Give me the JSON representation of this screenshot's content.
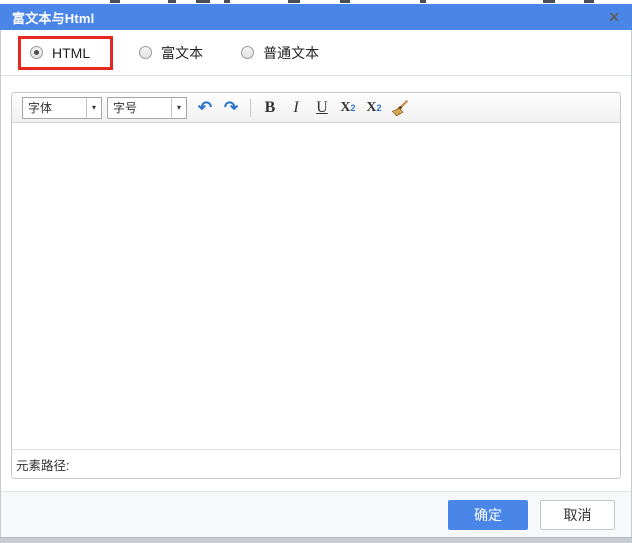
{
  "dialog": {
    "title": "富文本与Html"
  },
  "icons": {
    "close": "✕",
    "undo": "↶",
    "redo": "↷",
    "dropdown_arrow": "▾"
  },
  "mode_selector": {
    "options": [
      {
        "label": "HTML",
        "selected": true,
        "highlighted": true
      },
      {
        "label": "富文本",
        "selected": false,
        "highlighted": false
      },
      {
        "label": "普通文本",
        "selected": false,
        "highlighted": false
      }
    ],
    "highlight_color": "#e6281e"
  },
  "toolbar": {
    "font_family": {
      "value": "字体"
    },
    "font_size": {
      "value": "字号"
    },
    "buttons": {
      "bold": "B",
      "italic": "I",
      "underline": "U",
      "script_base": "X",
      "superscript_digit": "2",
      "subscript_digit": "2"
    }
  },
  "editor": {
    "content": "",
    "element_path_label": "元素路径:"
  },
  "footer": {
    "ok_label": "确定",
    "cancel_label": "取消"
  },
  "colors": {
    "titlebar": "#4a86e8",
    "primary_button": "#4a86e8",
    "highlight_box": "#e6281e"
  }
}
